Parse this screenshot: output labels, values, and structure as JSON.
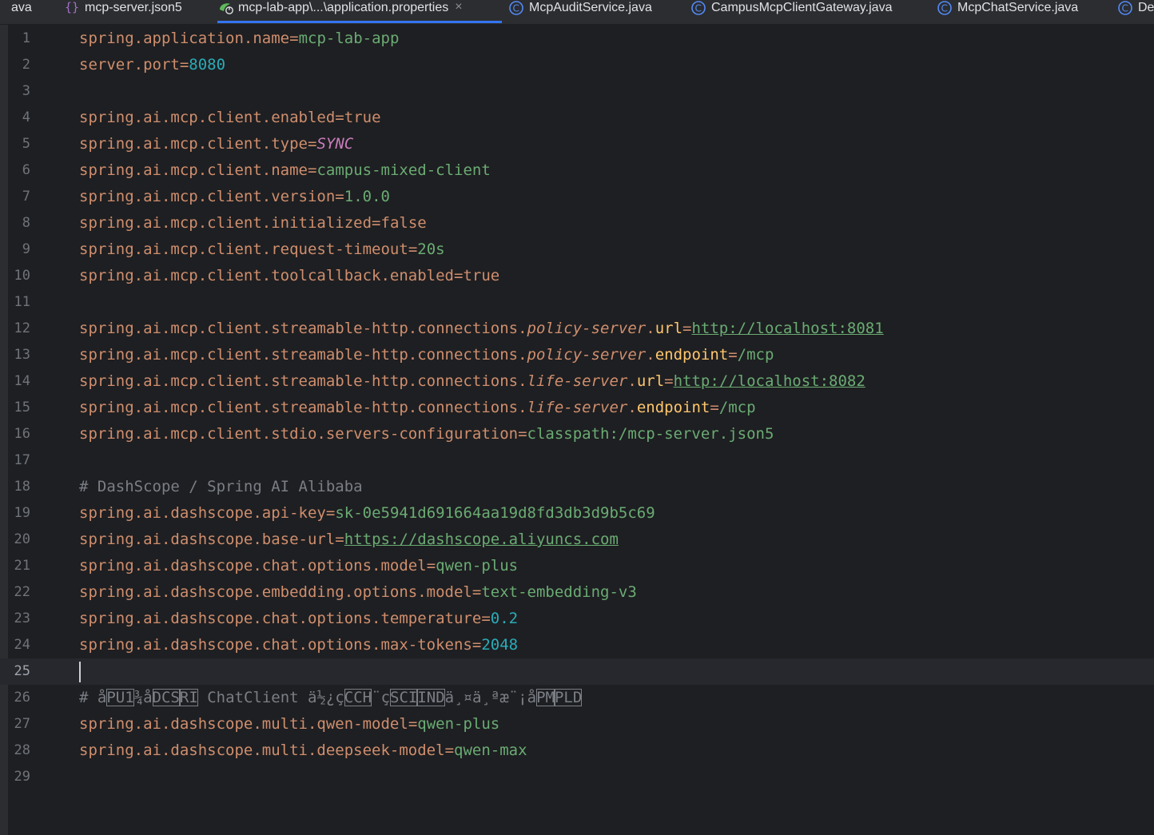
{
  "tabs": [
    {
      "label": "ava",
      "icon": "none"
    },
    {
      "label": "mcp-server.json5",
      "icon": "json-braces-icon"
    },
    {
      "label": "mcp-lab-app\\...\\application.properties",
      "icon": "spring-properties-icon",
      "active": true
    },
    {
      "label": "McpAuditService.java",
      "icon": "class-icon"
    },
    {
      "label": "CampusMcpClientGateway.java",
      "icon": "class-icon"
    },
    {
      "label": "McpChatService.java",
      "icon": "class-icon"
    },
    {
      "label": "De",
      "icon": "class-icon"
    }
  ],
  "close_glyph": "×",
  "line_numbers": [
    "1",
    "2",
    "3",
    "4",
    "5",
    "6",
    "7",
    "8",
    "9",
    "10",
    "11",
    "12",
    "13",
    "14",
    "15",
    "16",
    "17",
    "18",
    "19",
    "20",
    "21",
    "22",
    "23",
    "24",
    "25",
    "26",
    "27",
    "28",
    "29"
  ],
  "current_line": 25,
  "code": {
    "l1": {
      "key": "spring.application.name",
      "value": "mcp-lab-app"
    },
    "l2": {
      "key": "server.port",
      "value": "8080"
    },
    "l4": {
      "key": "spring.ai.mcp.client.enabled",
      "value": "true"
    },
    "l5": {
      "key": "spring.ai.mcp.client.type",
      "value": "SYNC"
    },
    "l6": {
      "key": "spring.ai.mcp.client.name",
      "value": "campus-mixed-client"
    },
    "l7": {
      "key": "spring.ai.mcp.client.version",
      "value": "1.0.0"
    },
    "l8": {
      "key": "spring.ai.mcp.client.initialized",
      "value": "false"
    },
    "l9": {
      "key": "spring.ai.mcp.client.request-timeout",
      "value": "20s"
    },
    "l10": {
      "key": "spring.ai.mcp.client.toolcallback.enabled",
      "value": "true"
    },
    "l12": {
      "prefix": "spring.ai.mcp.client.streamable-http.connections.",
      "map_key": "policy-server",
      "sep": ".",
      "prop": "url",
      "value": "http://localhost:8081"
    },
    "l13": {
      "prefix": "spring.ai.mcp.client.streamable-http.connections.",
      "map_key": "policy-server",
      "sep": ".",
      "prop": "endpoint",
      "value": "/mcp"
    },
    "l14": {
      "prefix": "spring.ai.mcp.client.streamable-http.connections.",
      "map_key": "life-server",
      "sep": ".",
      "prop": "url",
      "value": "http://localhost:8082"
    },
    "l15": {
      "prefix": "spring.ai.mcp.client.streamable-http.connections.",
      "map_key": "life-server",
      "sep": ".",
      "prop": "endpoint",
      "value": "/mcp"
    },
    "l16": {
      "key": "spring.ai.mcp.client.stdio.servers-configuration",
      "value": "classpath:/mcp-server.json5"
    },
    "l18": {
      "comment": "# DashScope / Spring AI Alibaba"
    },
    "l19": {
      "key": "spring.ai.dashscope.api-key",
      "value": "sk-0e5941d691664aa19d8fd3db3d9b5c69"
    },
    "l20": {
      "key": "spring.ai.dashscope.base-url",
      "value": "https://dashscope.aliyuncs.com"
    },
    "l21": {
      "key": "spring.ai.dashscope.chat.options.model",
      "value": "qwen-plus"
    },
    "l22": {
      "key": "spring.ai.dashscope.embedding.options.model",
      "value": "text-embedding-v3"
    },
    "l23": {
      "key": "spring.ai.dashscope.chat.options.temperature",
      "value": "0.2"
    },
    "l24": {
      "key": "spring.ai.dashscope.chat.options.max-tokens",
      "value": "2048"
    },
    "l26": {
      "parts": [
        "# å",
        "PU1",
        "¾å",
        "DCS",
        "RI",
        " ChatClient ä½¿ç",
        "CCH",
        "¨ç",
        "SCI",
        "IND",
        "ä¸¤ä¸ªæ¨¡å",
        "PM",
        "PLD"
      ]
    },
    "l27": {
      "key": "spring.ai.dashscope.multi.qwen-model",
      "value": "qwen-plus"
    },
    "l28": {
      "key": "spring.ai.dashscope.multi.deepseek-model",
      "value": "qwen-max"
    }
  }
}
